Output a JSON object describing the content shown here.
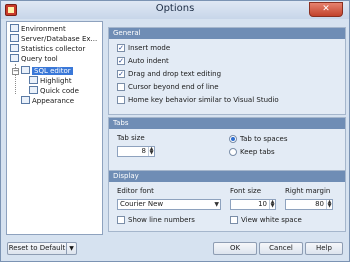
{
  "window": {
    "title": "Options",
    "close_glyph": "✕",
    "app_icon": "app-logo-icon"
  },
  "tree": {
    "items": [
      {
        "label": "Environment",
        "icon": "environment-icon"
      },
      {
        "label": "Server/Database Ex...",
        "icon": "server-database-icon"
      },
      {
        "label": "Statistics collector",
        "icon": "statistics-icon"
      },
      {
        "label": "Query tool",
        "icon": "query-tool-icon"
      },
      {
        "label": "SQL editor",
        "icon": "sql-editor-icon",
        "selected": true,
        "expander": "−"
      },
      {
        "label": "Highlight",
        "icon": "highlight-icon"
      },
      {
        "label": "Quick code",
        "icon": "quick-code-icon"
      },
      {
        "label": "Appearance",
        "icon": "appearance-icon"
      }
    ]
  },
  "general": {
    "header": "General",
    "options": [
      {
        "label": "Insert mode",
        "checked": true
      },
      {
        "label": "Auto indent",
        "checked": true
      },
      {
        "label": "Drag and drop text editing",
        "checked": true
      },
      {
        "label": "Cursor beyond end of line",
        "checked": false
      },
      {
        "label": "Home key behavior similar to Visual Studio",
        "checked": false
      }
    ]
  },
  "tabs": {
    "header": "Tabs",
    "tab_size_label": "Tab size",
    "tab_size_value": "8",
    "tab_to_spaces": "Tab to spaces",
    "keep_tabs": "Keep tabs",
    "selected": "tab_to_spaces"
  },
  "display": {
    "header": "Display",
    "editor_font_label": "Editor font",
    "editor_font_value": "Courier New",
    "font_size_label": "Font size",
    "font_size_value": "10",
    "right_margin_label": "Right margin",
    "right_margin_value": "80",
    "show_line_numbers": "Show line numbers",
    "view_white_space": "View white space"
  },
  "footer": {
    "reset_label": "Reset to Default",
    "ok_label": "OK",
    "cancel_label": "Cancel",
    "help_label": "Help"
  },
  "colors": {
    "panel_header": "#6f8db5",
    "selection": "#3a78d8",
    "window_bg": "#d6e2f0"
  }
}
